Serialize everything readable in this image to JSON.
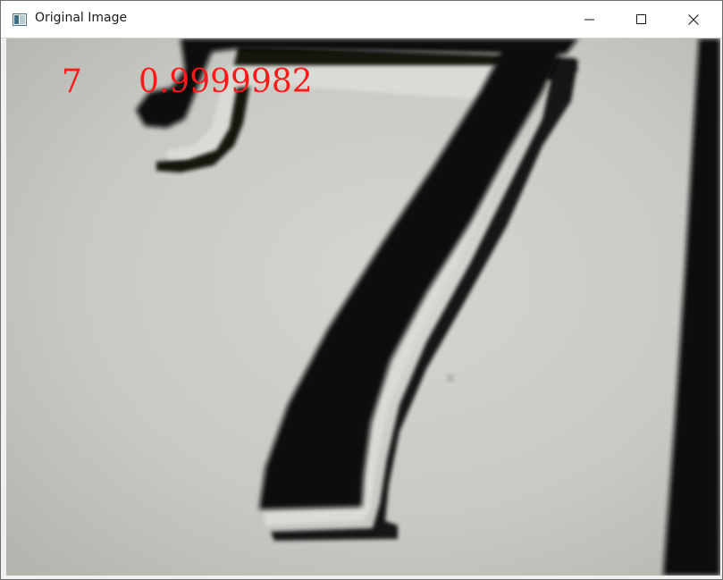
{
  "window": {
    "title": "Original Image",
    "icons": {
      "app": "image-window-icon",
      "minimize": "minimize-icon",
      "maximize": "maximize-icon",
      "close": "close-icon"
    }
  },
  "overlay": {
    "digit": "7",
    "score": "0.9999982",
    "color": "#ff1a1a"
  },
  "image": {
    "subject": "printed digit seven"
  }
}
